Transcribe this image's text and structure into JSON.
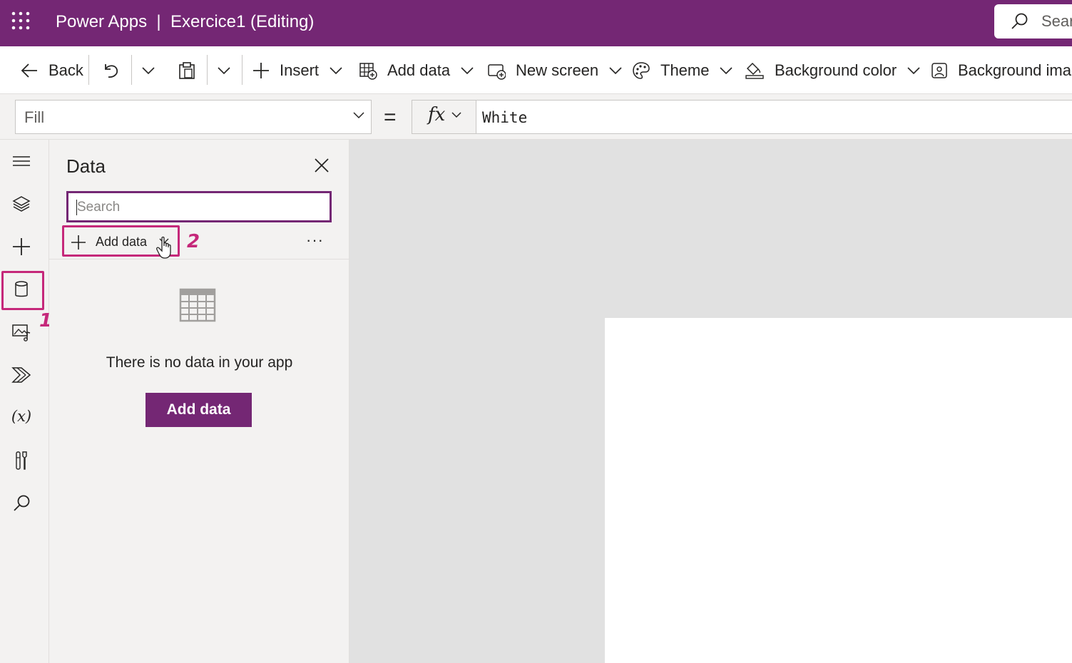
{
  "appbar": {
    "title": "Power Apps  |  Exercice1 (Editing)",
    "search_placeholder": "Search",
    "icons": [
      "waffle-icon",
      "search-icon"
    ]
  },
  "commandbar": {
    "back_label": "Back",
    "insert_label": "Insert",
    "add_data_label": "Add data",
    "new_screen_label": "New screen",
    "theme_label": "Theme",
    "background_color_label": "Background color",
    "background_image_label": "Background image"
  },
  "formulabar": {
    "property": "Fill",
    "equals": "=",
    "fx": "fx",
    "formula": "White"
  },
  "rail": {
    "variables_glyph": "(x)",
    "items": [
      "hamburger-icon",
      "layers-icon",
      "insert-plus-icon",
      "data-icon",
      "media-icon",
      "power-automate-icon",
      "variables-icon",
      "advanced-tools-icon",
      "search-icon"
    ]
  },
  "data_pane": {
    "title": "Data",
    "search_placeholder": "Search",
    "add_data_label": "Add data",
    "more_label": "···",
    "empty_message": "There is no data in your app",
    "primary_button_label": "Add data"
  },
  "annotations": {
    "step1": "1",
    "step2": "2"
  },
  "colors": {
    "brand": "#742774",
    "annotation": "#c5287a"
  }
}
